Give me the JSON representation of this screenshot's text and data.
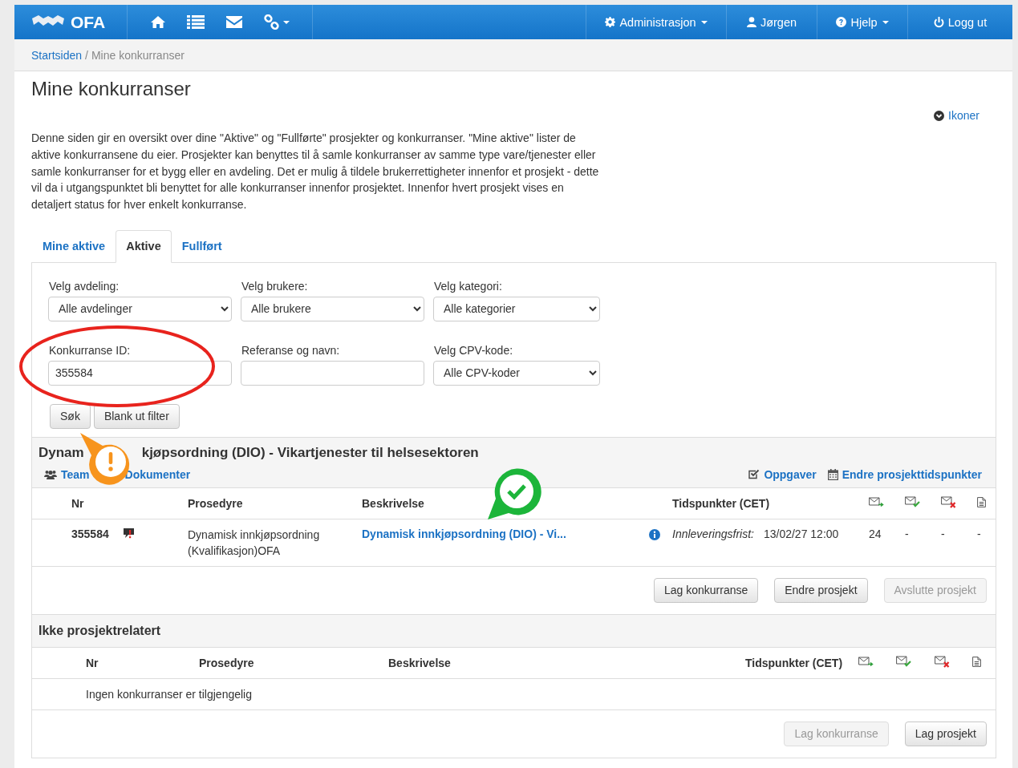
{
  "navbar": {
    "brand": "OFA",
    "icon_items": [
      {
        "kind": "home"
      },
      {
        "kind": "list"
      },
      {
        "kind": "mail"
      },
      {
        "kind": "link",
        "dropdown": true
      }
    ],
    "right_items": [
      {
        "label": "Administrasjon",
        "dropdown": true
      },
      {
        "label": "Jørgen",
        "dropdown": false
      },
      {
        "label": "Hjelp",
        "dropdown": true
      },
      {
        "label": "Logg ut",
        "dropdown": false
      }
    ]
  },
  "breadcrumb": [
    {
      "label": "Startsiden",
      "link": true
    },
    {
      "label": "Mine konkurranser",
      "link": false
    }
  ],
  "breadcrumb_separator": "/",
  "title": "Mine konkurranser",
  "icons_link": "Ikoner",
  "intro": "Denne siden gir en oversikt over dine \"Aktive\" og \"Fullførte\" prosjekter og konkurranser. \"Mine aktive\" lister de aktive konkurransene du eier. Prosjekter kan benyttes til å samle konkurranser av samme type vare/tjenester eller samle konkurranser for et bygg eller en avdeling. Det er mulig å tildele brukerrettigheter innenfor et prosjekt - dette vil da i utgangspunktet bli benyttet for alle konkurranser innenfor prosjektet. Innenfor hvert prosjekt vises en detaljert status for hver enkelt konkurranse.",
  "tabs": [
    {
      "label": "Mine aktive",
      "selected": false
    },
    {
      "label": "Aktive",
      "selected": true
    },
    {
      "label": "Fullført",
      "selected": false
    }
  ],
  "filters": [
    {
      "label": "Velg avdeling:",
      "kind": "select",
      "value": "Alle avdelinger"
    },
    {
      "label": "Velg brukere:",
      "kind": "select",
      "value": "Alle brukere"
    },
    {
      "label": "Velg kategori:",
      "kind": "select",
      "value": "Alle kategorier"
    },
    {
      "label": "Konkurranse ID:",
      "kind": "input",
      "value": "355584"
    },
    {
      "label": "Referanse og navn:",
      "kind": "input"
    },
    {
      "label": "Velg CPV-kode:",
      "kind": "select",
      "value": "Alle CPV-koder"
    }
  ],
  "filter_buttons": [
    "Søk",
    "Blank ut filter"
  ],
  "project": {
    "title_parts": [
      "Dynam",
      "kjøpsordning (DIO) - Vikartjenester til helsesektoren"
    ],
    "left_links": [
      {
        "label": "Team"
      },
      {
        "label": "Dokumenter"
      }
    ],
    "right_links": [
      {
        "label": "Oppgaver"
      },
      {
        "label": "Endre prosjekttidspunkter"
      }
    ],
    "columns": [
      "Nr",
      "Prosedyre",
      "Beskrivelse",
      "Tidspunkter (CET)"
    ],
    "rows": [
      {
        "nr": "355584",
        "comment": true,
        "procedure": "Dynamisk innkjøpsordning (Kvalifikasjon)OFA",
        "description": "Dynamisk innkjøpsordning (DIO) - Vi...",
        "deadline_label": "Innleveringsfrist:",
        "deadline": "13/02/27 12:00",
        "counts": [
          "24",
          "-",
          "-",
          "-"
        ]
      }
    ],
    "buttons": [
      {
        "label": "Lag konkurranse",
        "disabled": false
      },
      {
        "label": "Endre prosjekt",
        "disabled": false
      },
      {
        "label": "Avslutte prosjekt",
        "disabled": true
      }
    ]
  },
  "unrelated": {
    "title": "Ikke prosjektrelatert",
    "columns": [
      "Nr",
      "Prosedyre",
      "Beskrivelse",
      "Tidspunkter (CET)"
    ],
    "empty_message": "Ingen konkurranser er tilgjengelig",
    "buttons": [
      {
        "label": "Lag konkurranse",
        "disabled": true
      },
      {
        "label": "Lag prosjekt",
        "disabled": false
      }
    ]
  }
}
